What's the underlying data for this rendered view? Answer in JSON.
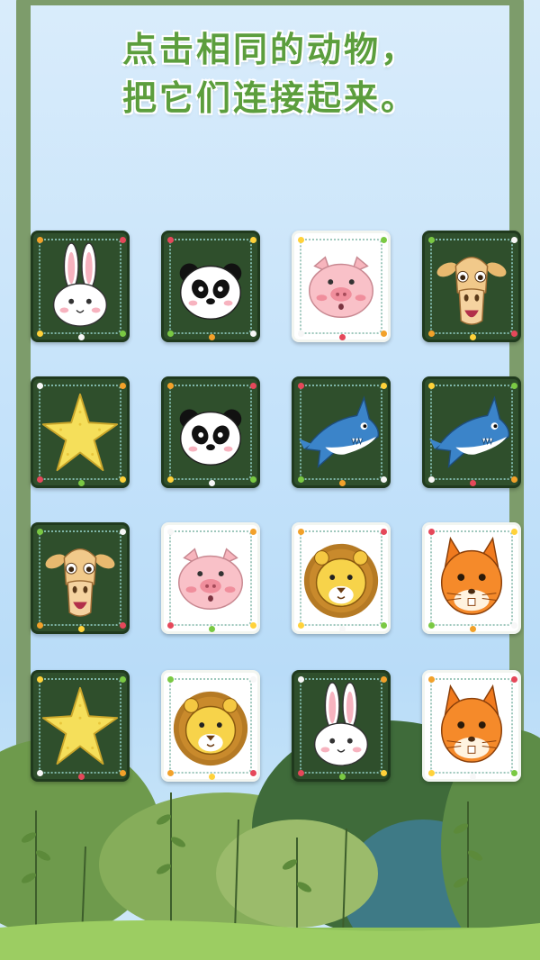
{
  "title": {
    "line1": "点击相同的动物，",
    "line2": "把它们连接起来。"
  },
  "colors": {
    "frame": "#7d9c6b",
    "title": "#5c9e3d",
    "card_back": "#2f4f2c",
    "card_front": "#ffffff"
  },
  "board": {
    "rows": 4,
    "cols": 4,
    "cards": [
      {
        "animal": "rabbit",
        "style": "dark"
      },
      {
        "animal": "panda",
        "style": "dark"
      },
      {
        "animal": "pig",
        "style": "light"
      },
      {
        "animal": "camel",
        "style": "dark"
      },
      {
        "animal": "starfish",
        "style": "dark"
      },
      {
        "animal": "panda",
        "style": "dark"
      },
      {
        "animal": "shark",
        "style": "dark"
      },
      {
        "animal": "shark",
        "style": "dark"
      },
      {
        "animal": "camel",
        "style": "dark"
      },
      {
        "animal": "pig",
        "style": "light"
      },
      {
        "animal": "lion",
        "style": "light"
      },
      {
        "animal": "squirrel",
        "style": "light"
      },
      {
        "animal": "starfish",
        "style": "dark"
      },
      {
        "animal": "lion",
        "style": "light"
      },
      {
        "animal": "rabbit",
        "style": "dark"
      },
      {
        "animal": "squirrel",
        "style": "light"
      }
    ]
  }
}
